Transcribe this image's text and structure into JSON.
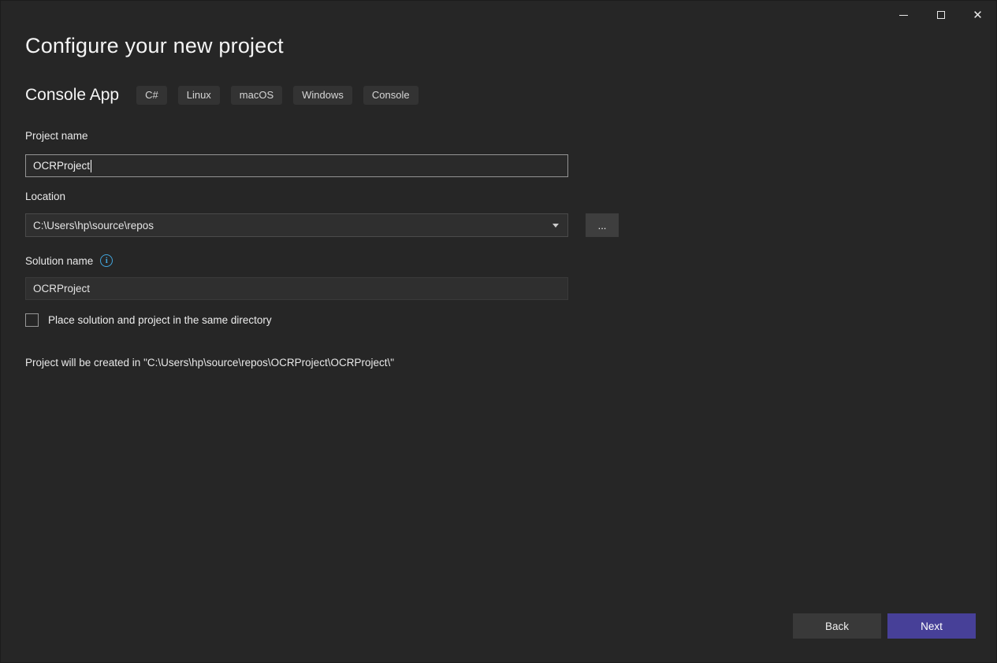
{
  "window": {
    "controls": {
      "minimize": "minimize",
      "maximize": "maximize",
      "close": "✕"
    }
  },
  "header": {
    "title": "Configure your new project"
  },
  "project_type": {
    "name": "Console App",
    "tags": [
      "C#",
      "Linux",
      "macOS",
      "Windows",
      "Console"
    ]
  },
  "form": {
    "project_name": {
      "label": "Project name",
      "value": "OCRProject"
    },
    "location": {
      "label": "Location",
      "value": "C:\\Users\\hp\\source\\repos",
      "browse_label": "..."
    },
    "solution_name": {
      "label": "Solution name",
      "value": "OCRProject",
      "info_glyph": "i"
    },
    "same_directory": {
      "label": "Place solution and project in the same directory",
      "checked": false
    },
    "created_in_text": "Project will be created in \"C:\\Users\\hp\\source\\repos\\OCRProject\\OCRProject\\\""
  },
  "footer": {
    "back_label": "Back",
    "next_label": "Next"
  },
  "colors": {
    "background": "#262626",
    "accent": "#474098",
    "info_icon": "#42a5dc",
    "tag_background": "#333333"
  }
}
